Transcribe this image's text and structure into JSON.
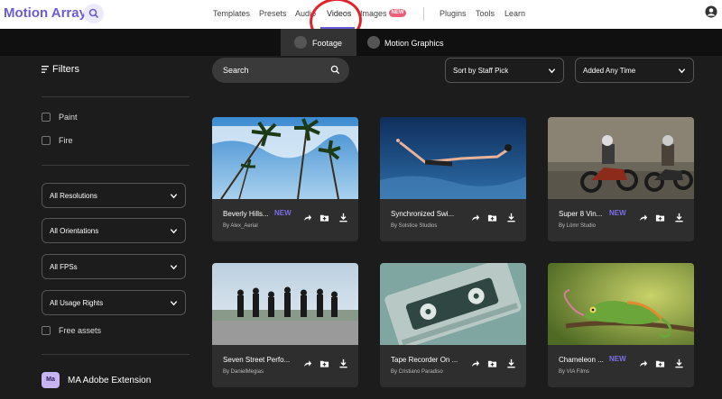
{
  "header": {
    "logo": "Motion Array",
    "nav": [
      "Templates",
      "Presets",
      "Audio",
      "Videos",
      "Images",
      "Plugins",
      "Tools",
      "Learn"
    ],
    "images_badge": "NEW",
    "active": "Videos"
  },
  "subnav": {
    "tabs": [
      {
        "label": "Footage",
        "active": true
      },
      {
        "label": "Motion Graphics",
        "active": false
      }
    ]
  },
  "sidebar": {
    "title": "Filters",
    "checkboxes": [
      "Paint",
      "Fire"
    ],
    "selects": [
      "All Resolutions",
      "All Orientations",
      "All FPSs",
      "All Usage Rights"
    ],
    "free_assets": "Free assets",
    "extension": {
      "icon_text": "Ma",
      "label": "MA Adobe Extension"
    }
  },
  "search": {
    "placeholder": "Search"
  },
  "sort": {
    "sort_by": "Sort by Staff Pick",
    "added": "Added Any Time"
  },
  "cards": [
    {
      "title": "Beverly Hills...",
      "new": "NEW",
      "author": "By Alex_Aerial"
    },
    {
      "title": "Synchronized Swi...",
      "new": "",
      "author": "By Solstice Studios"
    },
    {
      "title": "Super 8 Vin...",
      "new": "NEW",
      "author": "By Lömr Studio"
    },
    {
      "title": "Seven Street Perfo...",
      "new": "",
      "author": "By DanielMegias"
    },
    {
      "title": "Tape Recorder On ...",
      "new": "",
      "author": "By Cristiano Paradiso"
    },
    {
      "title": "Chameleon ...",
      "new": "NEW",
      "author": "By VIA Films"
    }
  ],
  "colors": {
    "accent": "#6a5cd6",
    "badge": "#ee5d7a",
    "background": "#1c1c1c",
    "annotation": "#e2222a"
  }
}
